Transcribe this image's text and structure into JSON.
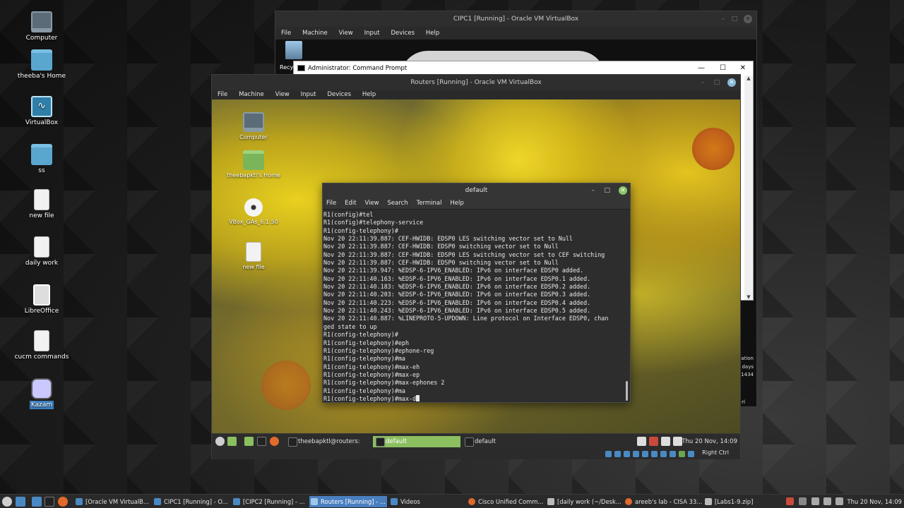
{
  "colors": {
    "host_accent": "#4a7fc0",
    "guest_accent": "#8bbf5f",
    "terminal_bg": "#2d2d2d",
    "terminal_fg": "#e8e8e8"
  },
  "desktop": {
    "icons": [
      {
        "label": "Computer",
        "icon": "computer-icon"
      },
      {
        "label": "theeba's Home",
        "icon": "home-folder-icon"
      },
      {
        "label": "VirtualBox",
        "icon": "virtualbox-icon"
      },
      {
        "label": "ss",
        "icon": "folder-icon"
      },
      {
        "label": "new file",
        "icon": "file-icon"
      },
      {
        "label": "daily work",
        "icon": "file-icon"
      },
      {
        "label": "LibreOffice",
        "icon": "libreoffice-icon"
      },
      {
        "label": "cucm commands",
        "icon": "file-icon"
      },
      {
        "label": "Kazam",
        "icon": "kazam-icon"
      }
    ]
  },
  "cipc_window": {
    "title": "CIPC1 [Running] - Oracle VM VirtualBox",
    "menu": [
      "File",
      "Machine",
      "View",
      "Input",
      "Devices",
      "Help"
    ],
    "recycle_label": "Recyc",
    "side_text": [
      "ation",
      "' days",
      "1434"
    ],
    "corner_text": "rl"
  },
  "cmd_window": {
    "title": "Administrator: Command Prompt",
    "minimize": "—",
    "maximize": "☐",
    "close": "✕"
  },
  "routers_window": {
    "title": "Routers [Running] - Oracle VM VirtualBox",
    "menu": [
      "File",
      "Machine",
      "View",
      "Input",
      "Devices",
      "Help"
    ],
    "guest_icons": [
      {
        "label": "Computer"
      },
      {
        "label": "theebapktl's Home"
      },
      {
        "label": "VBox_GAs_6.1.50"
      },
      {
        "label": "new file"
      }
    ],
    "status_right": "Right Ctrl"
  },
  "terminal": {
    "title": "default",
    "menu": [
      "File",
      "Edit",
      "View",
      "Search",
      "Terminal",
      "Help"
    ],
    "lines": [
      "R1(config)#tel",
      "R1(config)#telephony-service",
      "R1(config-telephony)#",
      "Nov 20 22:11:39.887: CEF-HWIDB: EDSP0 LES switching vector set to Null",
      "Nov 20 22:11:39.887: CEF-HWIDB: EDSP0 switching vector set to Null",
      "Nov 20 22:11:39.887: CEF-HWIDB: EDSP0 LES switching vector set to CEF switching",
      "Nov 20 22:11:39.887: CEF-HWIDB: EDSP0 switching vector set to Null",
      "Nov 20 22:11:39.947: %EDSP-6-IPV6_ENABLED: IPv6 on interface EDSP0 added.",
      "Nov 20 22:11:40.163: %EDSP-6-IPV6_ENABLED: IPv6 on interface EDSP0.1 added.",
      "Nov 20 22:11:40.183: %EDSP-6-IPV6_ENABLED: IPv6 on interface EDSP0.2 added.",
      "Nov 20 22:11:40.203: %EDSP-6-IPV6_ENABLED: IPv6 on interface EDSP0.3 added.",
      "Nov 20 22:11:40.223: %EDSP-6-IPV6_ENABLED: IPv6 on interface EDSP0.4 added.",
      "Nov 20 22:11:40.243: %EDSP-6-IPV6_ENABLED: IPv6 on interface EDSP0.5 added.",
      "Nov 20 22:11:40.887: %LINEPROTO-5-UPDOWN: Line protocol on Interface EDSP0, chan",
      "ged state to up",
      "R1(config-telephony)#",
      "R1(config-telephony)#eph",
      "R1(config-telephony)#ephone-reg",
      "R1(config-telephony)#ma",
      "R1(config-telephony)#max-eh",
      "R1(config-telephony)#max-ep",
      "R1(config-telephony)#max-ephones 2",
      "R1(config-telephony)#ma"
    ],
    "current_input": "R1(config-telephony)#max-d"
  },
  "guest_panel": {
    "tasks": [
      {
        "label": "theebapktl@routers: ~...",
        "active": false
      },
      {
        "label": "default",
        "active": true
      },
      {
        "label": "default",
        "active": false
      }
    ],
    "clock": "Thu 20 Nov, 14:09"
  },
  "taskbar": {
    "tasks": [
      {
        "label": "[Oracle VM VirtualB...",
        "active": false
      },
      {
        "label": "CIPC1 [Running] - O...",
        "active": false
      },
      {
        "label": "[CIPC2 [Running] - ...",
        "active": false
      },
      {
        "label": "Routers [Running] - ...",
        "active": true
      },
      {
        "label": "Videos",
        "active": false
      },
      {
        "label": "Cisco Unified Comm...",
        "active": false
      },
      {
        "label": "[daily work (~/Desk...",
        "active": false
      },
      {
        "label": "areeb's lab - CISA 33...",
        "active": false
      },
      {
        "label": "[Labs1-9.zip]",
        "active": false
      }
    ],
    "clock": "Thu 20 Nov, 14:09"
  }
}
